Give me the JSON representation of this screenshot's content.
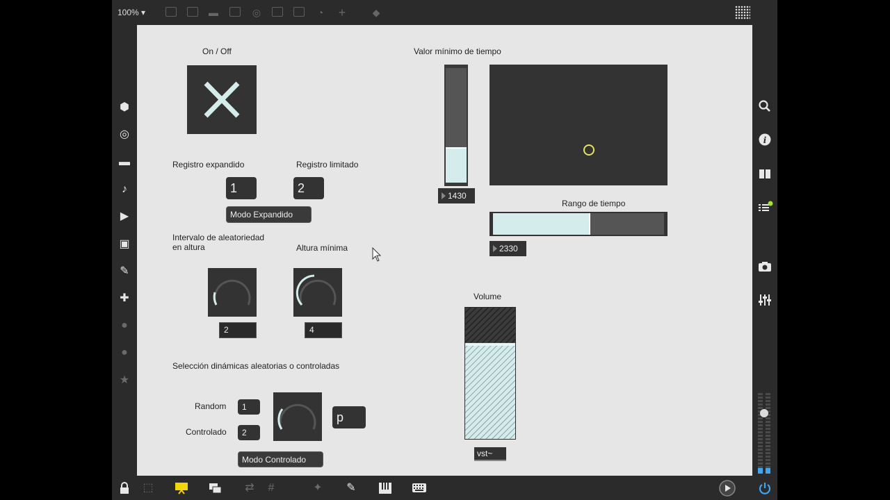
{
  "toolbar": {
    "zoom_label": "100% ▾",
    "icons": [
      "presentation-icon",
      "message-icon",
      "comment-icon",
      "close-box-icon",
      "target-icon",
      "terminal-icon",
      "split-icon",
      "gauge-icon",
      "plus-icon",
      "paint-bucket-icon"
    ]
  },
  "left_sidebar": {
    "icons": [
      "package-icon",
      "target-icon",
      "bar-icon",
      "music-note-icon",
      "media-icon",
      "image-icon",
      "paperclip-icon",
      "plug-icon",
      "vst-icon",
      "b-icon",
      "star-icon"
    ]
  },
  "right_sidebar": {
    "icons": [
      "search-icon",
      "info-icon",
      "book-icon",
      "list-icon",
      "camera-icon",
      "mixer-icon"
    ]
  },
  "canvas": {
    "onoff_label": "On / Off",
    "reg_expandido_label": "Registro expandido",
    "reg_limitado_label": "Registro limitado",
    "num_1": "1",
    "num_2": "2",
    "modo_expandido": "Modo Expandido",
    "intervalo_label": "Intervalo de aleatoriedad en altura",
    "altura_label": "Altura mínima",
    "dial1_value": "2",
    "dial2_value": "4",
    "seleccion_label": "Selección dinámicas aleatorias o controladas",
    "random_label": "Random",
    "random_value": "1",
    "controlado_label": "Controlado",
    "controlado_value": "2",
    "p_box": "p",
    "modo_controlado": "Modo Controlado",
    "valor_min_label": "Valor mínimo de tiempo",
    "valor_min_value": "1430",
    "valor_min_fill": 0.3,
    "rango_label": "Rango de tiempo",
    "rango_value": "2330",
    "rango_fill": 0.56,
    "volume_label": "Volume",
    "volume_fill": 0.72,
    "vst_label": "vst~"
  },
  "colors": {
    "accent": "#d5eced",
    "canvas_bg": "#e6e6e6",
    "dark": "#333333",
    "status_green": "#a6e22e",
    "power_blue": "#3ea6f0"
  }
}
